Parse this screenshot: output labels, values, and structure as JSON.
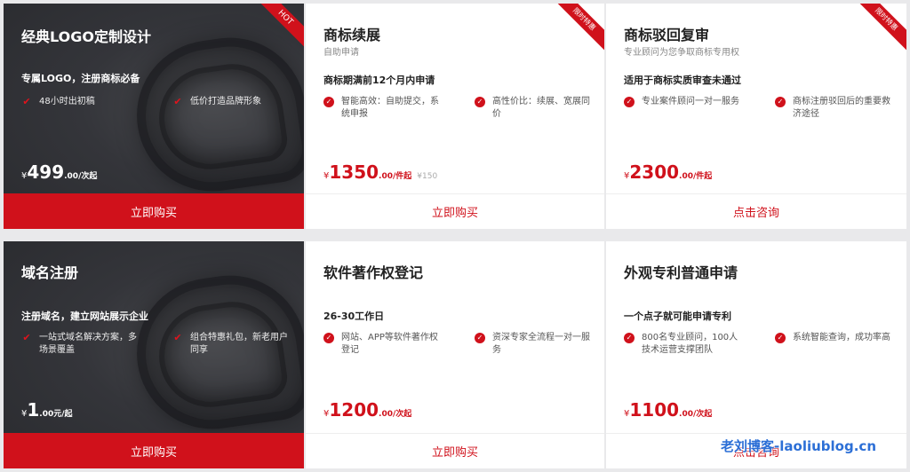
{
  "cards": [
    {
      "title": "经典LOGO定制设计",
      "badge": "HOT",
      "headline": "专属LOGO，注册商标必备",
      "features": [
        "48小时出初稿",
        "低价打造品牌形象"
      ],
      "price": {
        "currency": "¥",
        "amount": "499",
        "unit": ".00/次起"
      },
      "button": "立即购买"
    },
    {
      "title": "商标续展",
      "subtitle": "自助申请",
      "badge": "限时特惠",
      "headline": "商标期满前12个月内申请",
      "features": [
        "智能高效：自助提交，系统申报",
        "高性价比：续展、宽展同价"
      ],
      "price": {
        "currency": "¥",
        "amount": "1350",
        "unit": ".00/件起",
        "original": "¥150"
      },
      "button": "立即购买"
    },
    {
      "title": "商标驳回复审",
      "subtitle": "专业顾问为您争取商标专用权",
      "badge": "限时特惠",
      "headline": "适用于商标实质审查未通过",
      "features": [
        "专业案件顾问一对一服务",
        "商标注册驳回后的重要救济途径"
      ],
      "price": {
        "currency": "¥",
        "amount": "2300",
        "unit": ".00/件起"
      },
      "button": "点击咨询"
    },
    {
      "title": "域名注册",
      "headline": "注册域名，建立网站展示企业",
      "features": [
        "一站式域名解决方案，多场景覆盖",
        "组合特惠礼包，新老用户同享"
      ],
      "price": {
        "currency": "¥",
        "amount": "1",
        "unit": ".00元/起"
      },
      "button": "立即购买"
    },
    {
      "title": "软件著作权登记",
      "headline": "26-30工作日",
      "features": [
        "网站、APP等软件著作权登记",
        "资深专家全流程一对一服务"
      ],
      "price": {
        "currency": "¥",
        "amount": "1200",
        "unit": ".00/次起"
      },
      "button": "立即购买"
    },
    {
      "title": "外观专利普通申请",
      "headline": "一个点子就可能申请专利",
      "features": [
        "800名专业顾问，100人技术运营支撑团队",
        "系统智能查询，成功率高"
      ],
      "price": {
        "currency": "¥",
        "amount": "1100",
        "unit": ".00/次起"
      },
      "button": "点击咨询"
    }
  ],
  "watermark": "老刘博客-laoliublog.cn"
}
